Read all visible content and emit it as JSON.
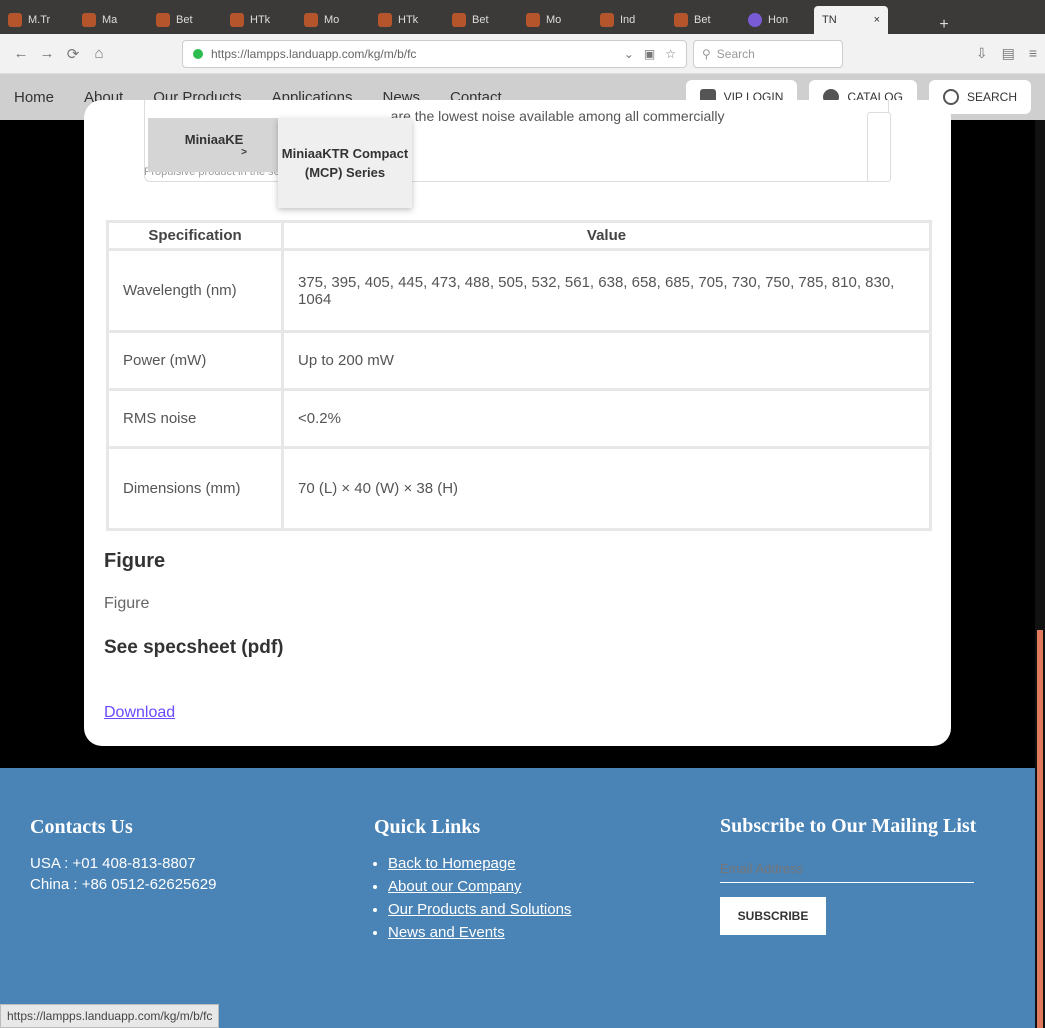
{
  "browser": {
    "tabs": [
      {
        "label": "M.Tr"
      },
      {
        "label": "Ma"
      },
      {
        "label": "Bet"
      },
      {
        "label": "HTk"
      },
      {
        "label": "Mo"
      },
      {
        "label": "HTk"
      },
      {
        "label": "Bet"
      },
      {
        "label": "Mo"
      },
      {
        "label": "Ind"
      },
      {
        "label": "Bet"
      },
      {
        "label": "Hon"
      }
    ],
    "active_tab": {
      "label": "TN",
      "close": "×"
    },
    "new_tab": "+",
    "url": "https://lampps.landuapp.com/kg/m/b/fc",
    "search_placeholder": "Search"
  },
  "site_menu": {
    "items": [
      "Home",
      "About",
      "Our Products",
      "Applications",
      "News",
      "Contact"
    ],
    "buttons": {
      "login": "VIP LOGIN",
      "catalog": "CATALOG",
      "search": "SEARCH"
    }
  },
  "dropdown": {
    "item1": "MiniaaKE",
    "item2": "MiniaaKTR Compact (MCP) Series"
  },
  "card": {
    "top_text": "...are the lowest noise available among all commercially",
    "top_small": "Propulsive product in the series"
  },
  "spec_table": {
    "headers": [
      "Specification",
      "Value"
    ],
    "rows": [
      {
        "key": "Wavelength (nm)",
        "value": "375, 395, 405, 445, 473, 488, 505, 532, 561, 638, 658, 685, 705, 730, 750, 785, 810, 830, 1064"
      },
      {
        "key": "Power (mW)",
        "value": "Up to 200 mW"
      },
      {
        "key": "RMS noise",
        "value": "<0.2%"
      },
      {
        "key": "Dimensions (mm)",
        "value": "70 (L) × 40 (W) × 38 (H)"
      }
    ]
  },
  "figure": {
    "heading": "Figure",
    "text": "Figure"
  },
  "specsheet": {
    "heading": "See specsheet (pdf)",
    "link": "Download"
  },
  "footer": {
    "contact": {
      "title": "Contacts Us",
      "lines": [
        "USA : +01 408-813-8807",
        "China : +86 0512-62625629"
      ]
    },
    "quick_links": {
      "title": "Quick Links",
      "items": [
        "Back to Homepage",
        "About our Company",
        "Our Products and Solutions",
        "News and Events"
      ]
    },
    "subscribe": {
      "title": "Subscribe to Our Mailing List",
      "placeholder": "Email Address",
      "button": "SUBSCRIBE"
    }
  },
  "status_bar": "https://lampps.landuapp.com/kg/m/b/fc"
}
